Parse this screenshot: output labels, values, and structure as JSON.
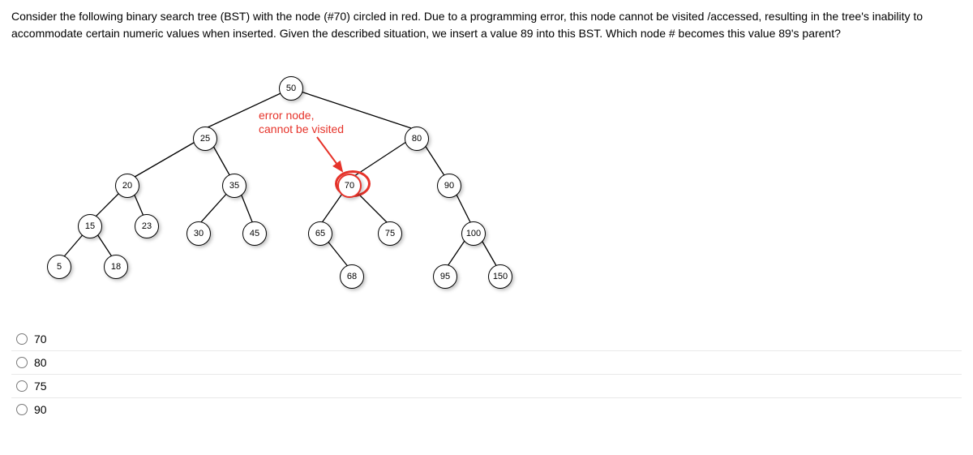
{
  "question": "Consider the following binary search tree (BST) with the node (#70) circled in red. Due to a programming error, this node cannot be visited /accessed, resulting in the tree's inability to accommodate certain numeric values when inserted. Given the described situation, we insert a value 89 into this BST. Which node # becomes this value 89's parent?",
  "annotation": {
    "line1": "error node,",
    "line2": "cannot be visited"
  },
  "nodes": {
    "n50": "50",
    "n25": "25",
    "n80": "80",
    "n20": "20",
    "n35": "35",
    "n70": "70",
    "n90": "90",
    "n15": "15",
    "n23": "23",
    "n30": "30",
    "n45": "45",
    "n65": "65",
    "n75": "75",
    "n100": "100",
    "n5": "5",
    "n18": "18",
    "n68": "68",
    "n95": "95",
    "n150": "150"
  },
  "options": [
    "70",
    "80",
    "75",
    "90"
  ]
}
